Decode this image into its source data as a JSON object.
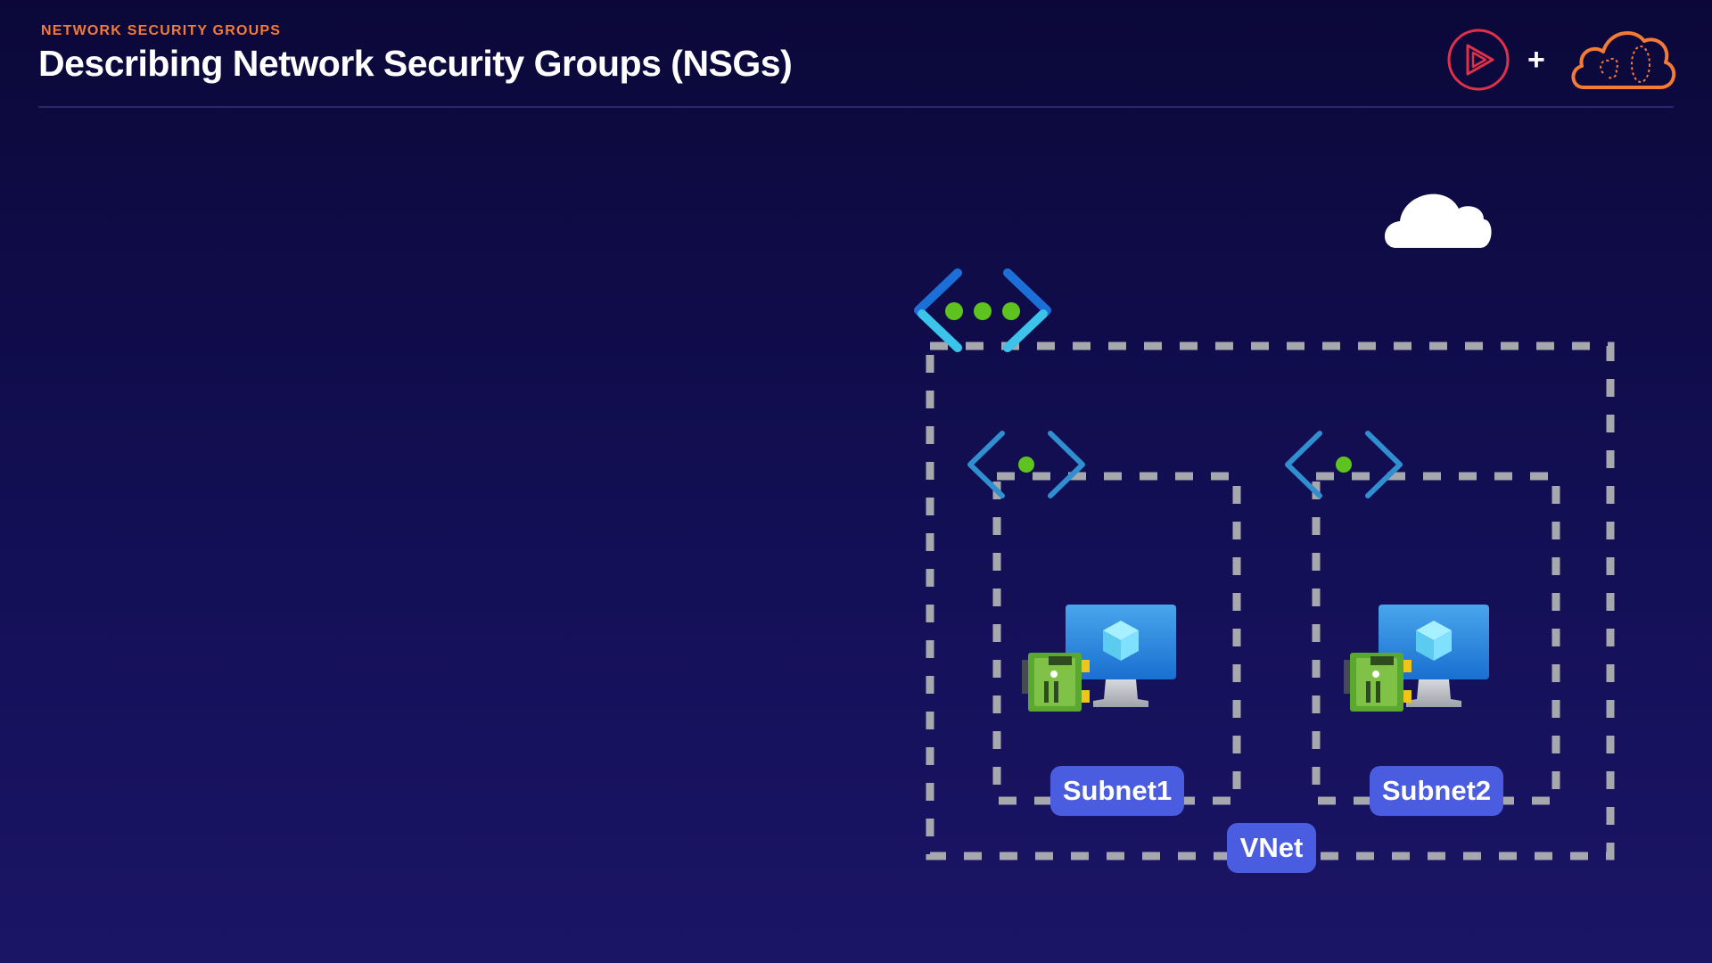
{
  "header": {
    "eyebrow": "NETWORK SECURITY GROUPS",
    "title": "Describing Network Security Groups (NSGs)"
  },
  "branding": {
    "logos": [
      "play-logo-icon",
      "cloud-logo-icon"
    ],
    "plus": "+",
    "colors": {
      "play": "#e0314a",
      "cloud": "#f47a36"
    }
  },
  "diagram": {
    "vnet_label": "VNet",
    "subnets": [
      {
        "label": "Subnet1"
      },
      {
        "label": "Subnet2"
      }
    ],
    "icons": [
      "internet-cloud-icon",
      "vnet-icon",
      "subnet-icon",
      "virtual-machine-icon",
      "network-interface-icon"
    ],
    "colors": {
      "tag": "#4a5de0",
      "dash": "#a7a8ad",
      "accent": "#5fc31f"
    }
  }
}
